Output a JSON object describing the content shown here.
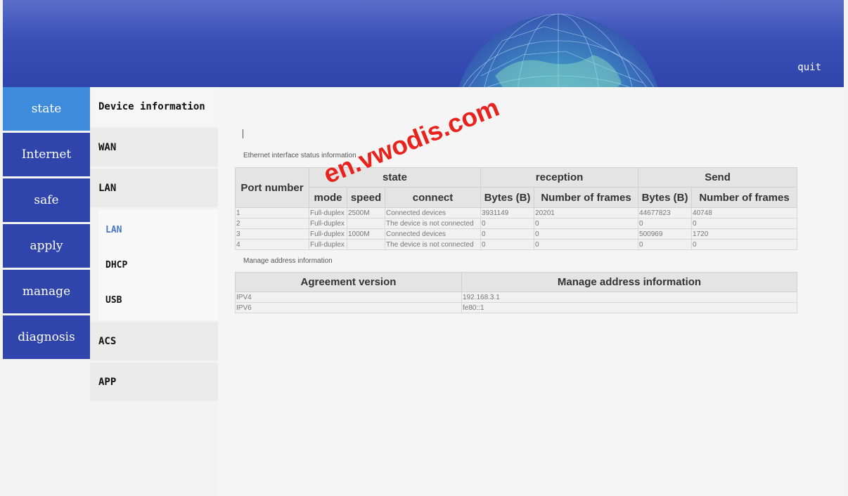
{
  "header": {
    "quit_label": "quit"
  },
  "main_menu": [
    {
      "label": "state",
      "active": true
    },
    {
      "label": "Internet"
    },
    {
      "label": "safe"
    },
    {
      "label": "apply"
    },
    {
      "label": "manage"
    },
    {
      "label": "diagnosis"
    }
  ],
  "sub_menu": {
    "device_information": "Device information",
    "wan": "WAN",
    "lan": "LAN",
    "lan_children": [
      "LAN",
      "DHCP",
      "USB"
    ],
    "acs": "ACS",
    "app": "APP"
  },
  "ethernet": {
    "title": "Ethernet interface status information",
    "headers": {
      "port_number": "Port number",
      "state": "state",
      "reception": "reception",
      "send": "Send",
      "mode": "mode",
      "speed": "speed",
      "connect": "connect",
      "bytes": "Bytes (B)",
      "frames": "Number of frames"
    },
    "rows": [
      [
        "1",
        "Full-duplex",
        "2500M",
        "Connected devices",
        "3931149",
        "20201",
        "44677823",
        "40748"
      ],
      [
        "2",
        "Full-duplex",
        "",
        "The device is not connected",
        "0",
        "0",
        "0",
        "0"
      ],
      [
        "3",
        "Full-duplex",
        "1000M",
        "Connected devices",
        "0",
        "0",
        "500969",
        "1720"
      ],
      [
        "4",
        "Full-duplex",
        "",
        "The device is not connected",
        "0",
        "0",
        "0",
        "0"
      ]
    ]
  },
  "manage_address": {
    "title": "Manage address information",
    "headers": {
      "version": "Agreement version",
      "address": "Manage address information"
    },
    "rows": [
      [
        "IPV4",
        "192.168.3.1"
      ],
      [
        "IPV6",
        "fe80::1"
      ]
    ]
  },
  "watermark": "en.vwodis.com",
  "colors": {
    "header": "#2f45ab",
    "menu": "#2f45ab",
    "menu_active": "#3f8bdc",
    "watermark": "#e8221c"
  }
}
